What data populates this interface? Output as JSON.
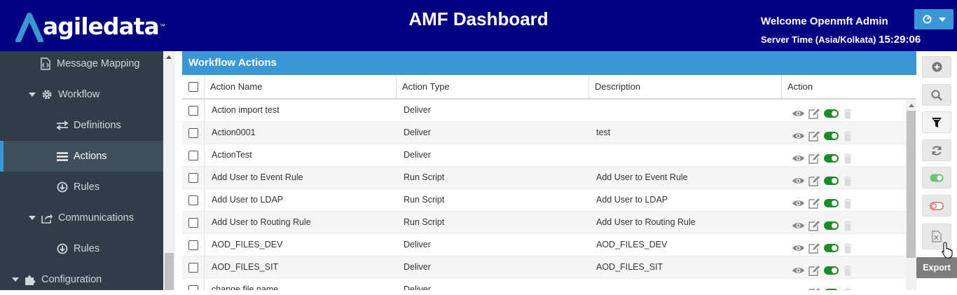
{
  "header": {
    "logo_text": "agiledata",
    "logo_tm": "™",
    "title": "AMF Dashboard",
    "welcome": "Welcome Openmft Admin",
    "server_time_label": "Server Time (Asia/Kolkata)",
    "server_time": "15:29:06"
  },
  "colors": {
    "header_bg": "#000080",
    "accent": "#3a96d4",
    "sidebar_bg": "#303d48",
    "toggle_on": "#1f8a2a"
  },
  "sidebar": {
    "items": [
      {
        "label": "Message Mapping",
        "icon": "code-file-icon"
      },
      {
        "label": "Workflow",
        "icon": "gear-icon",
        "expanded": true
      },
      {
        "label": "Definitions",
        "icon": "swap-arrows-icon"
      },
      {
        "label": "Actions",
        "icon": "list-icon",
        "active": true
      },
      {
        "label": "Rules",
        "icon": "circle-arrow-down-icon"
      },
      {
        "label": "Communications",
        "icon": "share-icon",
        "expanded": true
      },
      {
        "label": "Rules",
        "icon": "circle-arrow-down-icon"
      },
      {
        "label": "Configuration",
        "icon": "puzzle-icon",
        "expanded": true
      }
    ]
  },
  "panel": {
    "title": "Workflow Actions",
    "columns": [
      "Action Name",
      "Action Type",
      "Description",
      "Action"
    ]
  },
  "rows": [
    {
      "name": "Action import test",
      "type": "Deliver",
      "description": ""
    },
    {
      "name": "Action0001",
      "type": "Deliver",
      "description": "test"
    },
    {
      "name": "ActionTest",
      "type": "Deliver",
      "description": ""
    },
    {
      "name": "Add User to Event Rule",
      "type": "Run Script",
      "description": "Add User to Event Rule"
    },
    {
      "name": "Add User to LDAP",
      "type": "Run Script",
      "description": "Add User to LDAP"
    },
    {
      "name": "Add User to Routing Rule",
      "type": "Run Script",
      "description": "Add User to Routing Rule"
    },
    {
      "name": "AOD_FILES_DEV",
      "type": "Deliver",
      "description": "AOD_FILES_DEV"
    },
    {
      "name": "AOD_FILES_SIT",
      "type": "Deliver",
      "description": "AOD_FILES_SIT"
    },
    {
      "name": "change file name",
      "type": "Deliver",
      "description": ""
    }
  ],
  "toolbar": {
    "buttons": [
      "add-icon",
      "search-icon",
      "filter-icon",
      "refresh-icon",
      "toggle-on-icon",
      "toggle-off-icon",
      "export-excel-icon"
    ],
    "tooltip": "Export"
  }
}
